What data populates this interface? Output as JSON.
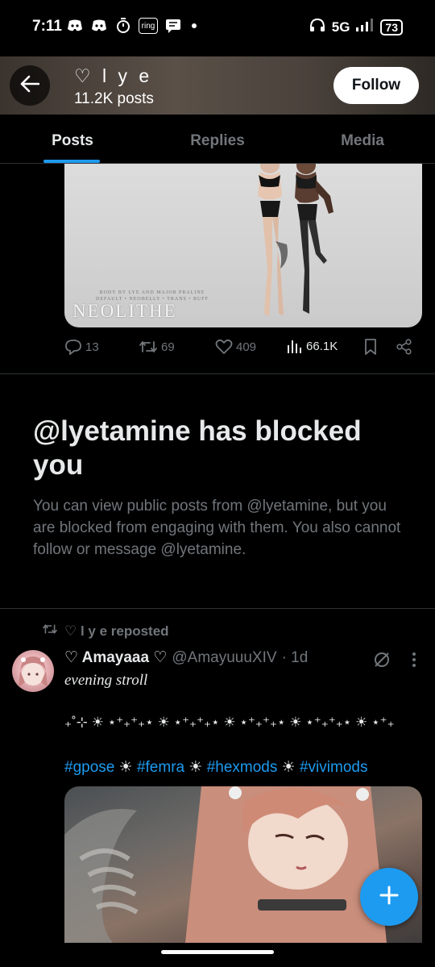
{
  "status_bar": {
    "time": "7:11",
    "network": "5G",
    "battery": "73",
    "icons_left": [
      "discord-icon",
      "discord-icon",
      "timer-icon",
      "ring-icon",
      "message-icon"
    ],
    "ring_label": "ring"
  },
  "header": {
    "name": "♡ l y e",
    "post_count": "11.2K posts",
    "follow_label": "Follow"
  },
  "tabs": [
    {
      "label": "Posts",
      "active": true
    },
    {
      "label": "Replies",
      "active": false
    },
    {
      "label": "Media",
      "active": false
    }
  ],
  "post1": {
    "image_caption_small": "BODY BY LYE AND MAJOR PRALINE\nDEFAULT • NEOBELLY • TRANS • BUFF",
    "image_caption_big": "NEOLITHE",
    "replies": "13",
    "reposts": "69",
    "likes": "409",
    "views": "66.1K"
  },
  "blocked": {
    "title": "@lyetamine has blocked you",
    "body": "You can view public posts from @lyetamine, but you are blocked from engaging with them. You also cannot follow or message @lyetamine."
  },
  "post2": {
    "repost_label": "♡ l y e reposted",
    "display_name": "♡ Amayaaa ♡",
    "handle": "@AmayuuuXIV",
    "time": "· 1d",
    "text_line1": "evening stroll",
    "text_line2": "₊˚⊹ ☀ ⋆⁺₊⁺₊⋆ ☀ ⋆⁺₊⁺₊⋆ ☀ ⋆⁺₊⁺₊⋆ ☀ ⋆⁺₊⁺₊⋆ ☀ ⋆⁺₊",
    "hashtags": [
      "#gpose",
      "#femra",
      "#hexmods",
      "#vivimods"
    ],
    "sun": "☀"
  },
  "colors": {
    "accent": "#1d9bf0",
    "muted": "#71767b",
    "background": "#000000"
  }
}
